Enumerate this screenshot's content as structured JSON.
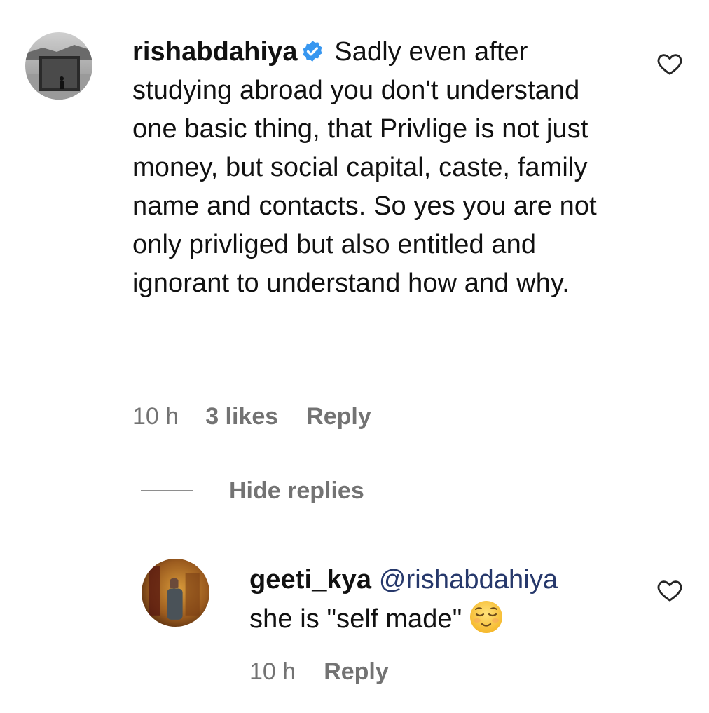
{
  "comment": {
    "username": "rishabdahiya",
    "verified": true,
    "text": "Sadly even after studying abroad you don't understand one basic thing, that Privlige is not just money, but social capital, caste, family name and contacts. So yes you are not only privliged but also entitled and ignorant to understand how and why.",
    "time": "10 h",
    "likes": "3 likes",
    "reply_label": "Reply"
  },
  "replies_toggle": {
    "label": "Hide replies"
  },
  "reply": {
    "username": "geeti_kya",
    "mention": "@rishabdahiya",
    "text": "she is \"self made\"",
    "emoji": "relieved-face-emoji",
    "time": "10 h",
    "reply_label": "Reply"
  },
  "colors": {
    "text": "#111111",
    "meta": "#737373",
    "mention": "#26386b",
    "verified": "#3897f0"
  }
}
